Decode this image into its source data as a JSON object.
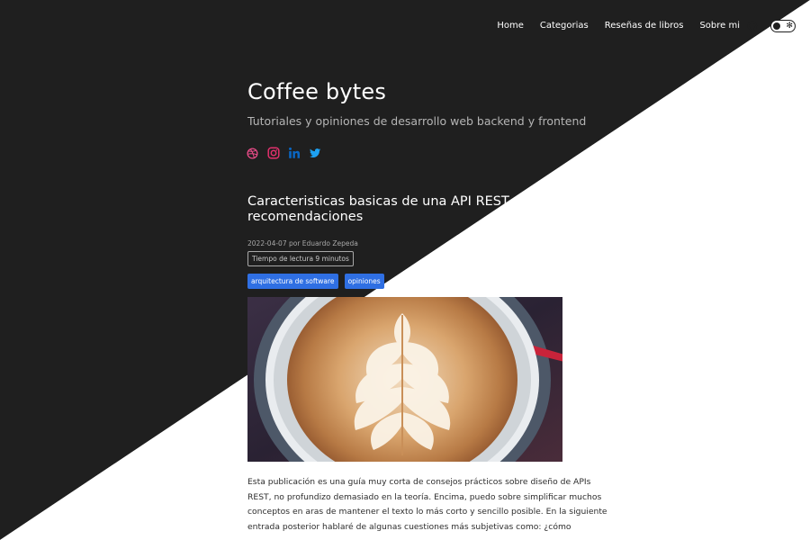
{
  "nav": {
    "items": [
      "Home",
      "Categorias",
      "Reseñas de libros",
      "Sobre mi"
    ],
    "search_icon": "search-icon",
    "toggle_icon": "sun-icon"
  },
  "header": {
    "title": "Coffee bytes",
    "subtitle": "Tutoriales y opiniones de desarrollo web backend y frontend",
    "social_icons": [
      "dribbble-icon",
      "instagram-icon",
      "linkedin-icon",
      "twitter-icon"
    ]
  },
  "post": {
    "title": "Caracteristicas basicas de una API REST y recomendaciones",
    "meta": "2022-04-07 por Eduardo Zepeda",
    "reading_time": "Tiempo de lectura 9 minutos",
    "tags": [
      "arquitectura de software",
      "opiniones"
    ],
    "image_alt": "latte-art-coffee-image",
    "body_lines": [
      "Esta publicación es una guía muy corta de consejos prácticos sobre diseño de APIs",
      "REST, no profundizo demasiado en la teoría. Encima, puedo sobre simplificar muchos",
      "conceptos en aras de mantener el texto lo más corto y sencillo posible. En la siguiente",
      "entrada posterior hablaré de algunas cuestiones más subjetivas como: ¿cómo"
    ]
  },
  "colors": {
    "dark_bg": "#1f1f1f",
    "light_bg": "#ffffff",
    "tag_blue": "#2f6fe3",
    "dribbble": "#ea4c89",
    "instagram": "#e1306c",
    "linkedin": "#0a66c2",
    "twitter": "#1da1f2"
  }
}
